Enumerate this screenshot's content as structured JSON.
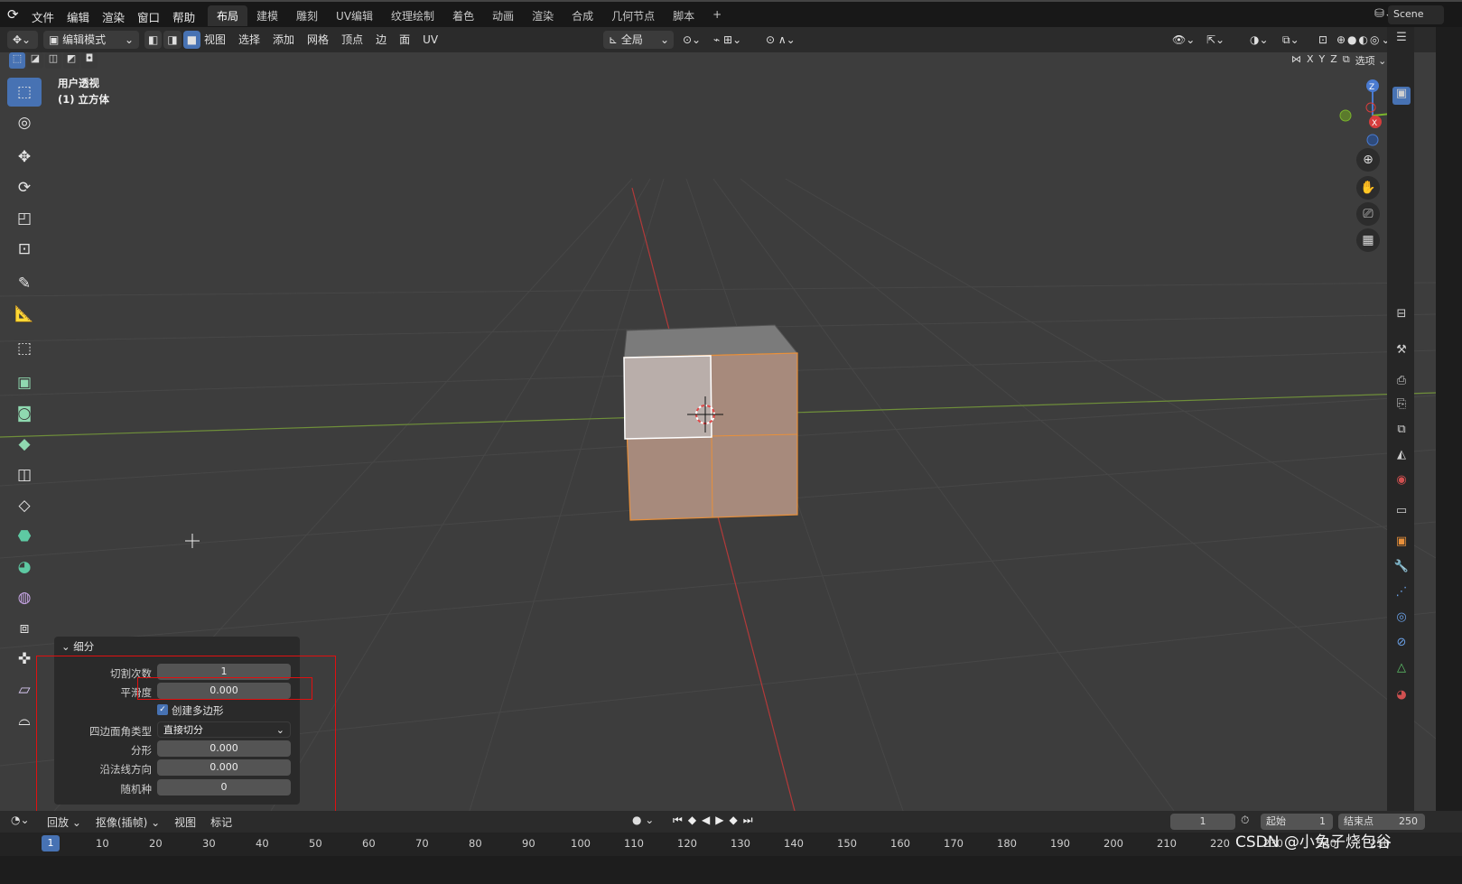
{
  "menu": [
    "文件",
    "编辑",
    "渲染",
    "窗口",
    "帮助"
  ],
  "workspaces": [
    "布局",
    "建模",
    "雕刻",
    "UV编辑",
    "纹理绘制",
    "着色",
    "动画",
    "渲染",
    "合成",
    "几何节点",
    "脚本"
  ],
  "workspace_active": "布局",
  "scene_label": "Scene",
  "header": {
    "mode": "编辑模式",
    "menus": [
      "视图",
      "选择",
      "添加",
      "网格",
      "顶点",
      "边",
      "面",
      "UV"
    ],
    "transform": "全局",
    "axes": [
      "X",
      "Y",
      "Z"
    ],
    "options": "选项"
  },
  "viewport": {
    "view_name": "用户透视",
    "object_name": "(1) 立方体"
  },
  "gizmo": {
    "z": "Z",
    "y": "Y",
    "x": "X"
  },
  "subdivide_panel": {
    "title": "细分",
    "number_of_cuts_label": "切割次数",
    "number_of_cuts": "1",
    "smoothness_label": "平滑度",
    "smoothness": "0.000",
    "create_ngons_label": "创建多边形",
    "create_ngons_checked": true,
    "quad_corner_label": "四边面角类型",
    "quad_corner_value": "直接切分",
    "fractal_label": "分形",
    "fractal": "0.000",
    "along_normal_label": "沿法线方向",
    "along_normal": "0.000",
    "random_seed_label": "随机种",
    "random_seed": "0"
  },
  "timeline": {
    "playback": "回放",
    "keying": "抠像(插帧)",
    "view": "视图",
    "marker": "标记",
    "current_frame": "1",
    "start_label": "起始",
    "start": "1",
    "end_label": "结束点",
    "end": "250",
    "ruler": [
      "1",
      "10",
      "20",
      "30",
      "40",
      "50",
      "60",
      "70",
      "80",
      "90",
      "100",
      "110",
      "120",
      "130",
      "140",
      "150",
      "160",
      "170",
      "180",
      "190",
      "200",
      "210",
      "220",
      "230",
      "240",
      "250"
    ]
  },
  "watermark": "CSDN @小兔子烧包谷",
  "colors": {
    "accent": "#4772b3",
    "selection_orange": "#e8903b",
    "highlight_red": "#e01010"
  }
}
